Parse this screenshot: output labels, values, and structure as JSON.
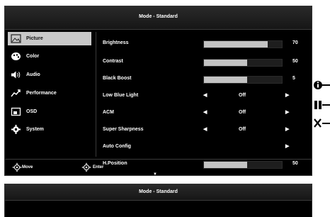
{
  "title": "Mode - Standard",
  "sidebar": {
    "items": [
      {
        "label": "Picture",
        "icon": "picture-icon",
        "active": true
      },
      {
        "label": "Color",
        "icon": "palette-icon"
      },
      {
        "label": "Audio",
        "icon": "speaker-icon"
      },
      {
        "label": "Performance",
        "icon": "performance-icon"
      },
      {
        "label": "OSD",
        "icon": "osd-icon"
      },
      {
        "label": "System",
        "icon": "gear-icon"
      }
    ]
  },
  "settings": [
    {
      "label": "Brightness",
      "type": "slider",
      "value": "70",
      "level": 0.82
    },
    {
      "label": "Contrast",
      "type": "slider",
      "value": "50",
      "level": 0.55
    },
    {
      "label": "Black Boost",
      "type": "slider",
      "value": "5",
      "level": 0.55
    },
    {
      "label": "Low Blue Light",
      "type": "option",
      "value": "Off"
    },
    {
      "label": "ACM",
      "type": "option",
      "value": "Off"
    },
    {
      "label": "Super Sharpness",
      "type": "option",
      "value": "Off"
    },
    {
      "label": "Auto Config",
      "type": "submenu"
    },
    {
      "label": "H.Position",
      "type": "slider",
      "value": "50",
      "level": 0.55
    }
  ],
  "footer": {
    "move": "Move",
    "enter": "Enter"
  },
  "lower_title": "Mode - Standard",
  "side_keys": [
    {
      "icon": "info-icon"
    },
    {
      "icon": "input-icon"
    },
    {
      "icon": "close-icon"
    }
  ]
}
